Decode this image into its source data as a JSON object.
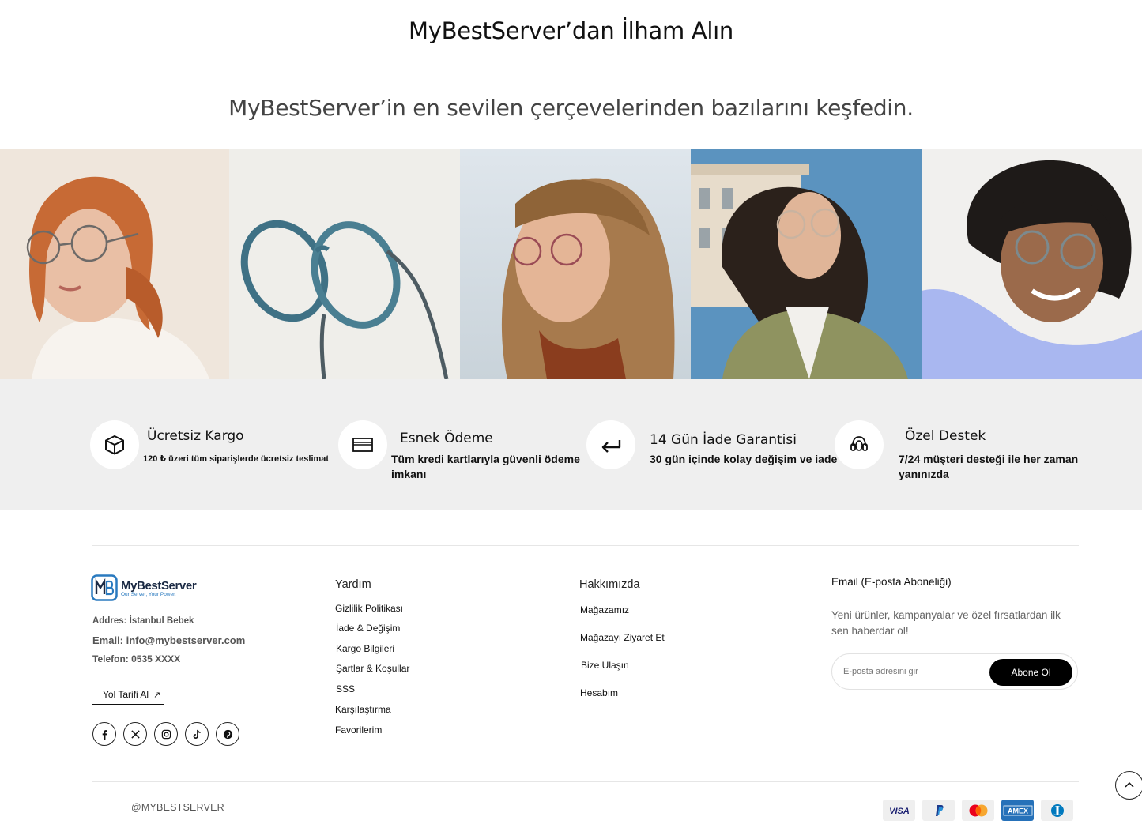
{
  "hero": {
    "title": "MyBestServer’dan İlham Alın",
    "subtitle": "MyBestServer’in en sevilen çerçevelerinden bazılarını keşfedin."
  },
  "features": [
    {
      "icon": "box-icon",
      "title": "Ücretsiz Kargo",
      "desc": "120 ₺ üzeri tüm siparişlerde ücretsiz teslimat"
    },
    {
      "icon": "credit-card-icon",
      "title": "Esnek Ödeme",
      "desc": "Tüm kredi kartlarıyla güvenli ödeme imkanı"
    },
    {
      "icon": "return-arrow-icon",
      "title": "14 Gün İade Garantisi",
      "desc": "30 gün içinde kolay değişim ve iade"
    },
    {
      "icon": "headset-icon",
      "title": "Özel Destek",
      "desc": "7/24 müşteri desteği ile her zaman yanınızda"
    }
  ],
  "footer": {
    "brand": {
      "name": "MyBestServer",
      "tagline": "Our Server, Your Power."
    },
    "address": "Addres: İstanbul Bebek",
    "email": "Email: info@mybestserver.com",
    "phone": "Telefon: 0535 XXXX",
    "directions": "Yol Tarifi Al",
    "socials": [
      "facebook-icon",
      "x-icon",
      "instagram-icon",
      "tiktok-icon",
      "pinterest-icon"
    ],
    "help": {
      "title": "Yardım",
      "links": [
        "Gizlilik Politikası",
        "İade & Değişim",
        "Kargo Bilgileri",
        "Şartlar & Koşullar",
        "SSS",
        "Karşılaştırma",
        "Favorilerim"
      ]
    },
    "about": {
      "title": "Hakkımızda",
      "links": [
        "Mağazamız",
        "Mağazayı Ziyaret Et",
        "Bize Ulaşın",
        "Hesabım"
      ]
    },
    "newsletter": {
      "title": "Email (E-posta Aboneliği)",
      "desc": "Yeni ürünler, kampanyalar ve özel fırsatlardan ilk sen haberdar ol!",
      "placeholder": "E-posta adresini gir",
      "button": "Abone Ol"
    },
    "copyright": "@MYBESTSERVER",
    "payments": [
      "VISA",
      "PayPal",
      "Mastercard",
      "AMEX",
      "Diners"
    ]
  }
}
